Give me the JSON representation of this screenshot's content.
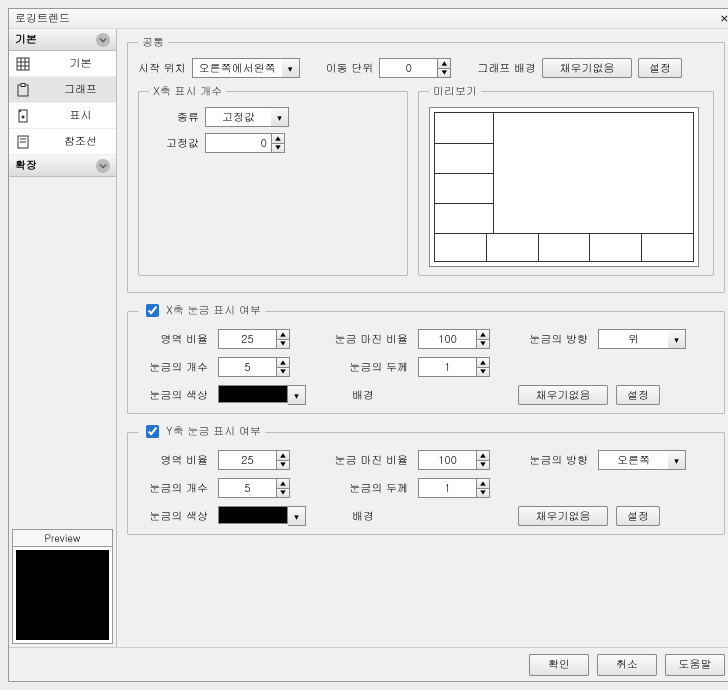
{
  "window": {
    "title": "로깅트렌드",
    "close_glyph": "⨯"
  },
  "sidebar": {
    "cat_basic": "기본",
    "cat_ext": "확장",
    "items": [
      {
        "label": "기본"
      },
      {
        "label": "그래프"
      },
      {
        "label": "표시"
      },
      {
        "label": "참조선"
      }
    ],
    "preview_label": "Preview"
  },
  "common": {
    "legend": "공통",
    "start_label": "시작 위치",
    "start_value": "오른쪽에서왼쪽",
    "move_label": "이동 단위",
    "move_value": "0",
    "bg_label": "그래프 배경",
    "bg_value": "채우기없음",
    "bg_set": "설정"
  },
  "xcount": {
    "legend": "X축 표시 개수",
    "kind_label": "종류",
    "kind_value": "고정값",
    "fixed_label": "고정값",
    "fixed_value": "0"
  },
  "preview": {
    "legend": "미리보기"
  },
  "xtick": {
    "legend": "X축 눈금 표시 여부",
    "checked": true,
    "area_label": "영역 비율",
    "area_value": "25",
    "margin_label": "눈금 마진 비율",
    "margin_value": "100",
    "dir_label": "눈금의 방향",
    "dir_value": "위",
    "count_label": "눈금의 개수",
    "count_value": "5",
    "thick_label": "눈금의 두께",
    "thick_value": "1",
    "color_label": "눈금의 색상",
    "color_value": "#000000",
    "bg_label": "배경",
    "bg_value": "채우기없음",
    "bg_set": "설정"
  },
  "ytick": {
    "legend": "Y축 눈금 표시 여부",
    "checked": true,
    "area_label": "영역 비율",
    "area_value": "25",
    "margin_label": "눈금 마진 비율",
    "margin_value": "100",
    "dir_label": "눈금의 방향",
    "dir_value": "오른쪽",
    "count_label": "눈금의 개수",
    "count_value": "5",
    "thick_label": "눈금의 두께",
    "thick_value": "1",
    "color_label": "눈금의 색상",
    "color_value": "#000000",
    "bg_label": "배경",
    "bg_value": "채우기없음",
    "bg_set": "설정"
  },
  "footer": {
    "ok": "확인",
    "cancel": "취소",
    "help": "도움말"
  }
}
